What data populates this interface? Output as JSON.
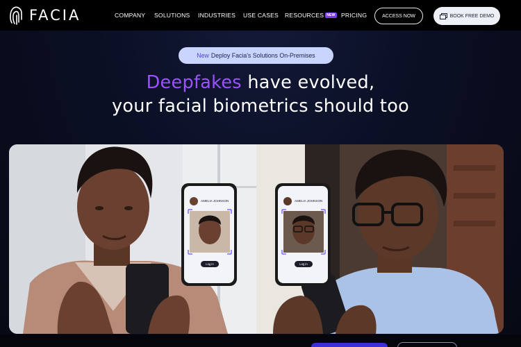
{
  "brand": {
    "name": "FACIA"
  },
  "nav": {
    "items": [
      {
        "label": "COMPANY"
      },
      {
        "label": "SOLUTIONS"
      },
      {
        "label": "INDUSTRIES"
      },
      {
        "label": "USE CASES"
      },
      {
        "label": "RESOURCES",
        "badge": "NEW"
      },
      {
        "label": "PRICING"
      }
    ],
    "access_label": "ACCESS NOW",
    "demo_label": "BOOK FREE DEMO"
  },
  "announcement": {
    "tag": "New",
    "text": "Deploy Facia's Solutions On-Premises"
  },
  "hero": {
    "headline_accent": "Deepfakes",
    "headline_rest": "have evolved,",
    "headline_line2": "your facial biometrics should too",
    "phone_left": {
      "name": "AMELIA JOHNSON",
      "button": "Log in"
    },
    "phone_right": {
      "name": "AMELIA JOHNSON",
      "button": "Log in"
    }
  },
  "colors": {
    "accent": "#9a52ff",
    "pill": "#c9d4ff",
    "background": "#0b0f24"
  }
}
